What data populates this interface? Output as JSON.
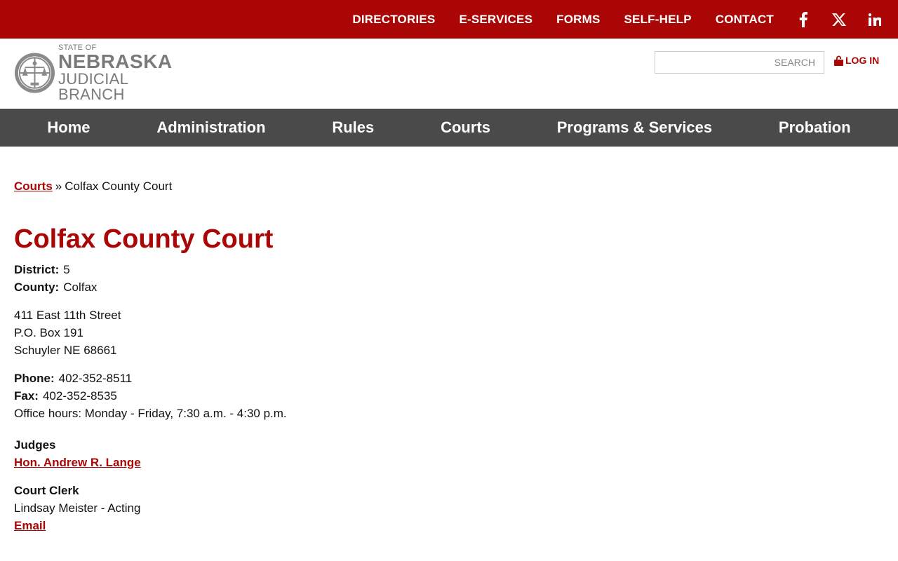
{
  "topbar": {
    "links": [
      "DIRECTORIES",
      "E-SERVICES",
      "FORMS",
      "SELF-HELP",
      "CONTACT"
    ],
    "social_icons": [
      "facebook-icon",
      "x-twitter-icon",
      "linkedin-icon"
    ],
    "background_color": "#aa0606"
  },
  "header": {
    "logo": {
      "state": "STATE OF",
      "name": "NEBRASKA",
      "branch": "JUDICIAL BRANCH"
    },
    "search": {
      "placeholder": "SEARCH",
      "value": ""
    },
    "login_label": "LOG IN"
  },
  "nav": {
    "items": [
      "Home",
      "Administration",
      "Rules",
      "Courts",
      "Programs & Services",
      "Probation"
    ],
    "background_color": "#4a4a4a"
  },
  "breadcrumb": {
    "parent": "Courts",
    "separator": "»",
    "current": "Colfax County Court"
  },
  "court": {
    "title": "Colfax County Court",
    "district_label": "District:",
    "district": "5",
    "county_label": "County:",
    "county": "Colfax",
    "address": [
      "411 East 11th Street",
      "P.O. Box 191",
      "Schuyler NE 68661"
    ],
    "phone_label": "Phone:",
    "phone": "402-352-8511",
    "fax_label": "Fax:",
    "fax": "402-352-8535",
    "hours": "Office hours: Monday - Friday, 7:30 a.m. - 4:30 p.m.",
    "judges_heading": "Judges",
    "judge": "Hon. Andrew R. Lange",
    "clerk_heading": "Court Clerk",
    "clerk": "Lindsay Meister - Acting",
    "email_label": "Email"
  },
  "colors": {
    "accent": "#aa0606"
  }
}
